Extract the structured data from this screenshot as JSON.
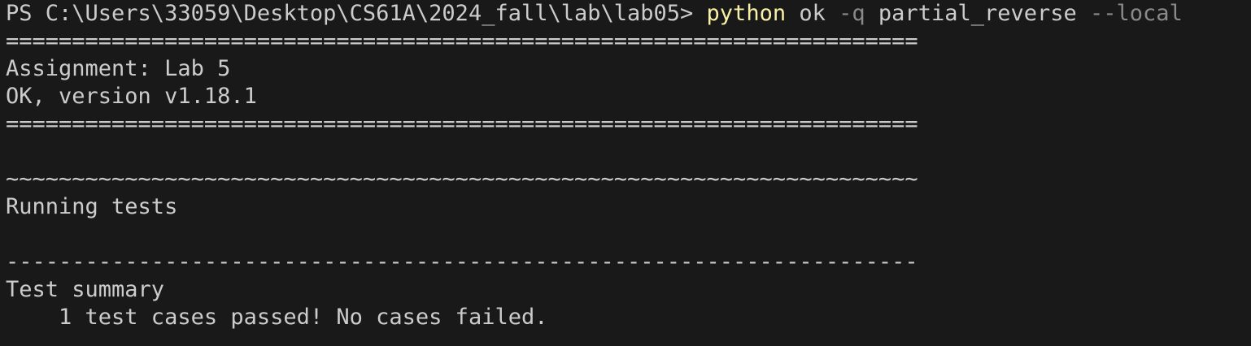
{
  "terminal": {
    "prompt": "PS C:\\Users\\33059\\Desktop\\CS61A\\2024_fall\\lab\\lab05> ",
    "command": {
      "executable": "python",
      "sep1": " ",
      "arg1": "ok",
      "sep2": " ",
      "flag1": "-q",
      "sep3": " ",
      "arg2": "partial_reverse",
      "sep4": " ",
      "flag2": "--local"
    },
    "lines": {
      "sep_top": "=====================================================================",
      "assignment": "Assignment: Lab 5",
      "version": "OK, version v1.18.1",
      "sep_bottom": "=====================================================================",
      "blank1": "",
      "tilde": "~~~~~~~~~~~~~~~~~~~~~~~~~~~~~~~~~~~~~~~~~~~~~~~~~~~~~~~~~~~~~~~~~~~~~",
      "running": "Running tests",
      "blank2": "",
      "dash": "---------------------------------------------------------------------",
      "summary": "Test summary",
      "result": "    1 test cases passed! No cases failed."
    }
  },
  "colors": {
    "background": "#191919",
    "text": "#cccccc",
    "python": "#f9f1a5",
    "parameter": "#8a8a8a"
  }
}
